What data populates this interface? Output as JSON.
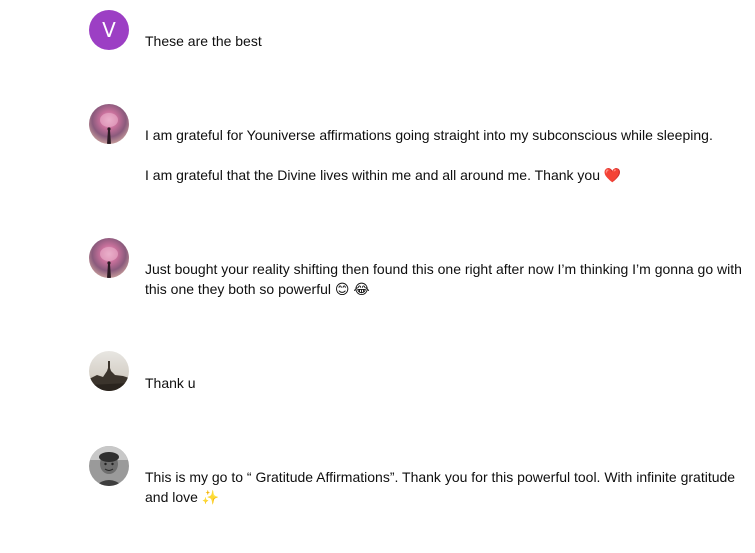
{
  "comments": [
    {
      "avatar_icon": "letter-avatar",
      "avatar_letter": "V",
      "avatar_color": "#9c3fc4",
      "text": "These are the best"
    },
    {
      "avatar_icon": "galaxy-photo-avatar",
      "text": "I am grateful for Youniverse affirmations going straight into my subconscious while sleeping.\n\nI am grateful that the Divine lives within me and all around me. Thank you ❤️"
    },
    {
      "avatar_icon": "galaxy-photo-avatar",
      "text": "Just bought your reality shifting then found this one right after now I’m thinking I’m gonna go with this one they both so powerful 😊 😂"
    },
    {
      "avatar_icon": "landscape-photo-avatar",
      "text": "Thank u"
    },
    {
      "avatar_icon": "person-photo-avatar",
      "text": "This is my go to “ Gratitude Affirmations”. Thank you for this powerful tool. With infinite gratitude and love ✨"
    }
  ]
}
